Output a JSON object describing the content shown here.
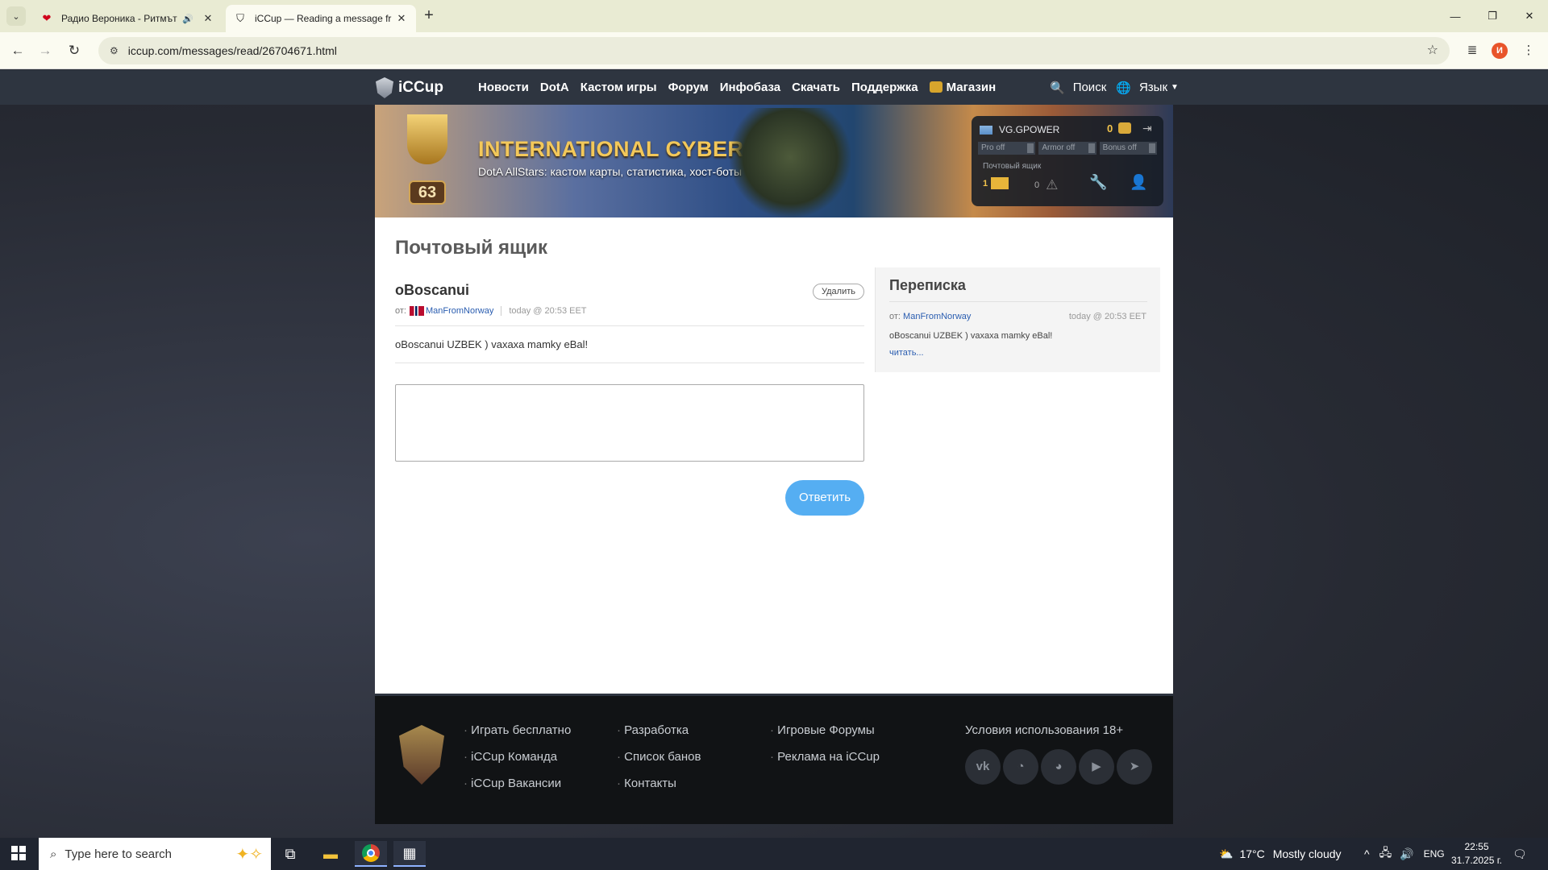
{
  "browser": {
    "tabs": [
      {
        "title": "Радио Вероника - Ритмът",
        "favicon": "heart-icon",
        "audio": true
      },
      {
        "title": "iCCup — Reading a message fr",
        "favicon": "iccup-icon",
        "active": true
      }
    ],
    "url": "iccup.com/messages/read/26704671.html",
    "profile_initial": "И"
  },
  "site": {
    "logo": "iCCup",
    "menu": [
      "Новости",
      "DotA",
      "Кастом игры",
      "Форум",
      "Инфобаза",
      "Скачать",
      "Поддержка",
      "Магазин"
    ],
    "search_label": "Поиск",
    "lang_label": "Язык"
  },
  "banner": {
    "title": "INTERNATIONAL CYBER CUP",
    "subtitle": "DotA AllStars: кастом карты, статистика, хост-боты",
    "level": "63"
  },
  "user_panel": {
    "username": "VG.GPOWER",
    "gold": "0",
    "toggles": [
      "Pro off",
      "Armor off",
      "Bonus off"
    ],
    "mailbox_label": "Почтовый ящик",
    "mail_count": "1",
    "warn_count": "0"
  },
  "mailbox": {
    "heading": "Почтовый ящик",
    "subject": "oBoscanui",
    "delete_label": "Удалить",
    "from_label": "от:",
    "sender": "ManFromNorway",
    "time": "today @ 20:53 EET",
    "body": "oBoscanui UZBEK ) vaxaxa mamky eBal!",
    "reply_placeholder": "",
    "reply_label": "Ответить"
  },
  "correspondence": {
    "heading": "Переписка",
    "from_label": "от:",
    "sender": "ManFromNorway",
    "time": "today @ 20:53 EET",
    "preview": "oBoscanui UZBEK ) vaxaxa mamky eBal!",
    "more": "читать..."
  },
  "footer": {
    "col1": [
      "Играть бесплатно",
      "iCCup Команда",
      "iCCup Вакансии"
    ],
    "col2": [
      "Разработка",
      "Список банов",
      "Контакты"
    ],
    "col3": [
      "Игровые Форумы",
      "Реклама на iCCup"
    ],
    "terms": "Условия использования 18+",
    "social": [
      "vk-icon",
      "discord-home-icon",
      "discord-settings-icon",
      "youtube-icon",
      "telegram-icon"
    ]
  },
  "taskbar": {
    "search_placeholder": "Type here to search",
    "weather_temp": "17°C",
    "weather_text": "Mostly cloudy",
    "lang": "ENG",
    "time": "22:55",
    "date": "31.7.2025 г."
  }
}
